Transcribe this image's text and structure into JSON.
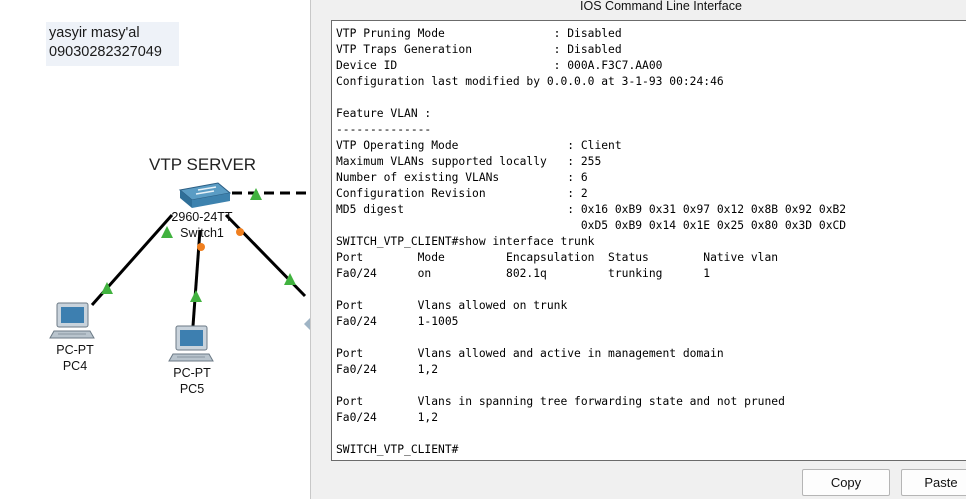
{
  "workspace": {
    "note": {
      "line1": "yasyir masy'al",
      "line2": "09030282327049"
    },
    "server_label": "VTP SERVER",
    "switch": {
      "model": "2960-24TT",
      "name": "Switch1",
      "icon": "switch-icon"
    },
    "pcs": [
      {
        "type": "PC-PT",
        "name": "PC4",
        "icon": "pc-icon"
      },
      {
        "type": "PC-PT",
        "name": "PC5",
        "icon": "pc-icon"
      }
    ],
    "colors": {
      "link_up": "#41b23f",
      "link_pending": "#f07f1f",
      "switch_blue": "#2f6f98"
    }
  },
  "cli": {
    "title": "IOS Command Line Interface",
    "lines": [
      "VTP Pruning Mode                : Disabled",
      "VTP Traps Generation            : Disabled",
      "Device ID                       : 000A.F3C7.AA00",
      "Configuration last modified by 0.0.0.0 at 3-1-93 00:24:46",
      "",
      "Feature VLAN :",
      "--------------",
      "VTP Operating Mode                : Client",
      "Maximum VLANs supported locally   : 255",
      "Number of existing VLANs          : 6",
      "Configuration Revision            : 2",
      "MD5 digest                        : 0x16 0xB9 0x31 0x97 0x12 0x8B 0x92 0xB2",
      "                                    0xD5 0xB9 0x14 0x1E 0x25 0x80 0x3D 0xCD",
      "SWITCH_VTP_CLIENT#show interface trunk",
      "Port        Mode         Encapsulation  Status        Native vlan",
      "Fa0/24      on           802.1q         trunking      1",
      "",
      "Port        Vlans allowed on trunk",
      "Fa0/24      1-1005",
      "",
      "Port        Vlans allowed and active in management domain",
      "Fa0/24      1,2",
      "",
      "Port        Vlans in spanning tree forwarding state and not pruned",
      "Fa0/24      1,2",
      "",
      "SWITCH_VTP_CLIENT#"
    ],
    "buttons": {
      "copy": "Copy",
      "paste": "Paste"
    }
  }
}
